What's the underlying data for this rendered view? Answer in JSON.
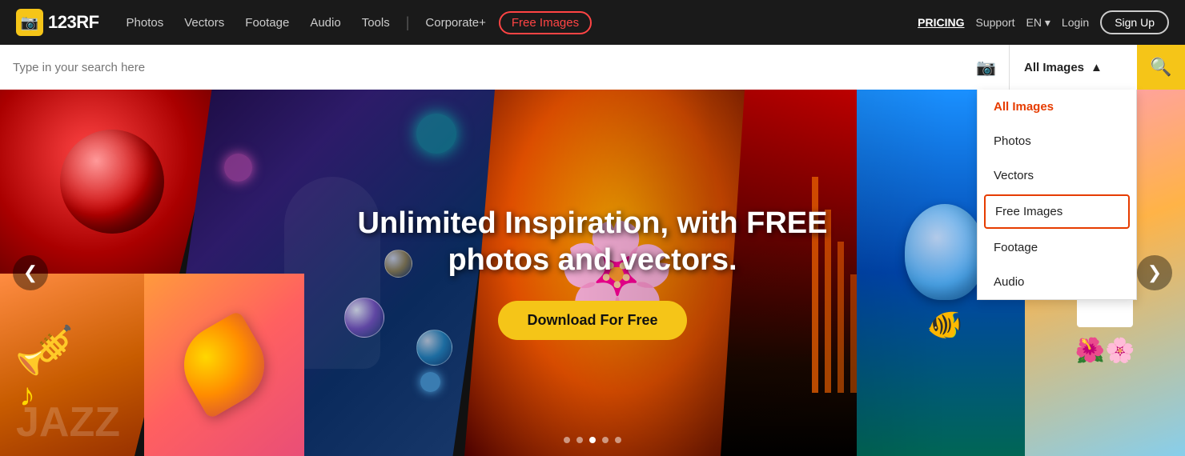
{
  "brand": {
    "logo_icon": "📷",
    "logo_text": "123RF"
  },
  "navbar": {
    "links": [
      {
        "label": "Photos",
        "id": "photos"
      },
      {
        "label": "Vectors",
        "id": "vectors"
      },
      {
        "label": "Footage",
        "id": "footage"
      },
      {
        "label": "Audio",
        "id": "audio"
      },
      {
        "label": "Tools",
        "id": "tools"
      },
      {
        "label": "Corporate+",
        "id": "corporate"
      }
    ],
    "free_images_label": "Free Images",
    "divider": "|",
    "pricing_label": "PRICING",
    "support_label": "Support",
    "lang_label": "EN",
    "login_label": "Login",
    "signup_label": "Sign Up"
  },
  "search": {
    "placeholder": "Type in your search here",
    "filter_label": "All Images",
    "filter_options": [
      {
        "label": "All Images",
        "id": "all",
        "active": true
      },
      {
        "label": "Photos",
        "id": "photos"
      },
      {
        "label": "Vectors",
        "id": "vectors"
      },
      {
        "label": "Free Images",
        "id": "free-images",
        "highlighted": true
      },
      {
        "label": "Footage",
        "id": "footage"
      },
      {
        "label": "Audio",
        "id": "audio"
      }
    ]
  },
  "hero": {
    "title": "Unlimited Inspiration, with FREE photos and vectors.",
    "cta_label": "Download For Free"
  },
  "carousel": {
    "prev_arrow": "❮",
    "next_arrow": "❯",
    "dots": [
      {
        "active": false
      },
      {
        "active": false
      },
      {
        "active": true
      },
      {
        "active": false
      },
      {
        "active": false
      }
    ]
  }
}
